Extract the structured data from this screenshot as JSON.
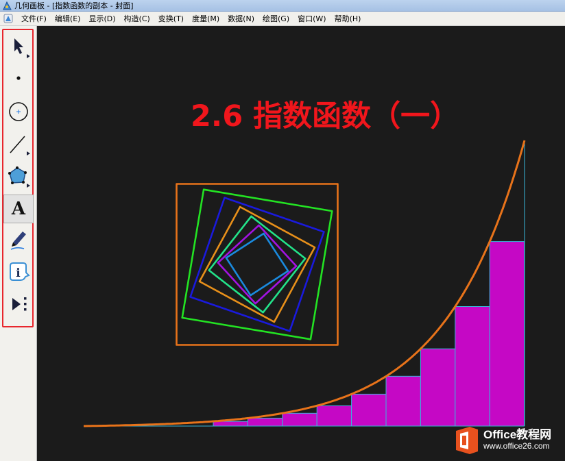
{
  "window": {
    "title": "几何画板 - [指数函数的副本 - 封面]"
  },
  "menubar": {
    "items": [
      "文件(F)",
      "编辑(E)",
      "显示(D)",
      "构造(C)",
      "变换(T)",
      "度量(M)",
      "数据(N)",
      "绘图(G)",
      "窗口(W)",
      "帮助(H)"
    ]
  },
  "toolbox": {
    "tools": [
      {
        "name": "arrow-select-tool",
        "icon": "arrow-icon"
      },
      {
        "name": "point-tool",
        "icon": "point-icon"
      },
      {
        "name": "compass-tool",
        "icon": "circle-icon"
      },
      {
        "name": "straightedge-tool",
        "icon": "segment-icon"
      },
      {
        "name": "polygon-tool",
        "icon": "polygon-icon"
      },
      {
        "name": "text-tool",
        "icon": "text-icon",
        "label": "A",
        "selected": true
      },
      {
        "name": "marker-tool",
        "icon": "marker-pen-icon"
      },
      {
        "name": "information-tool",
        "icon": "info-icon",
        "label": "i"
      },
      {
        "name": "custom-tool",
        "icon": "custom-tool-icon"
      }
    ],
    "frame_color": "#e8262d"
  },
  "sketch": {
    "title": "2.6 指数函数（一）",
    "title_color": "#f1161c",
    "background": "#1b1b1b",
    "curve_color": "#e8731a",
    "bar_color": "#c508c5",
    "bar_edge_color": "#38b8dc",
    "square_colors": [
      "#e8731a",
      "#23e323",
      "#1a1add",
      "#e8901a",
      "#23e38a",
      "#a213e3",
      "#1a8ade"
    ]
  },
  "watermark": {
    "brand": "Office教程网",
    "url": "www.office26.com",
    "logo_color": "#e7511e"
  }
}
